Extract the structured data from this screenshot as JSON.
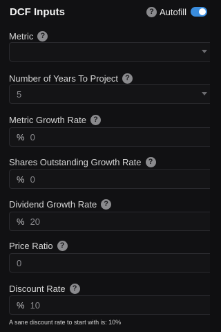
{
  "header": {
    "title": "DCF Inputs",
    "autofill_label": "Autofill",
    "autofill_on": true,
    "help_icon": "question-circle-icon"
  },
  "fields": {
    "metric": {
      "label": "Metric",
      "value": "",
      "type": "select"
    },
    "years": {
      "label": "Number of Years To Project",
      "value": "5",
      "type": "select"
    },
    "metric_growth": {
      "label": "Metric Growth Rate",
      "prefix": "%",
      "value": "0"
    },
    "shares_growth": {
      "label": "Shares Outstanding Growth Rate",
      "prefix": "%",
      "value": "0"
    },
    "dividend_growth": {
      "label": "Dividend Growth Rate",
      "prefix": "%",
      "value": "20"
    },
    "price_ratio": {
      "label": "Price Ratio",
      "value": "0"
    },
    "discount_rate": {
      "label": "Discount Rate",
      "prefix": "%",
      "value": "10"
    }
  },
  "hint": "A sane discount rate to start with is: 10%",
  "colors": {
    "background": "#111113",
    "accent": "#3a8dde",
    "help_icon": "#8a8a8d"
  }
}
